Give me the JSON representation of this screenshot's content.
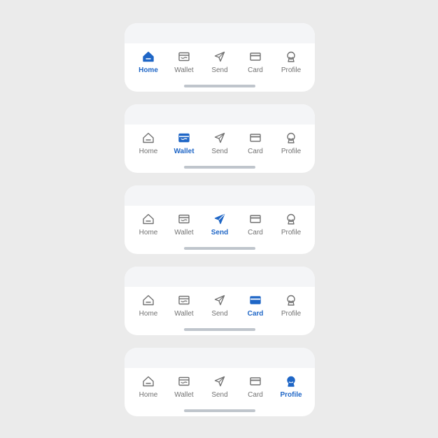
{
  "colors": {
    "background": "#ebebeb",
    "card": "#ffffff",
    "card_top": "#f4f5f7",
    "active": "#1f66c6",
    "inactive": "#727272",
    "indicator": "#bfc5cc"
  },
  "nav_labels": [
    "Home",
    "Wallet",
    "Send",
    "Card",
    "Profile"
  ],
  "nav_icons": [
    "home-icon",
    "wallet-icon",
    "send-icon",
    "card-icon",
    "profile-icon"
  ],
  "variants": [
    {
      "active": "Home"
    },
    {
      "active": "Wallet"
    },
    {
      "active": "Send"
    },
    {
      "active": "Card"
    },
    {
      "active": "Profile"
    }
  ]
}
